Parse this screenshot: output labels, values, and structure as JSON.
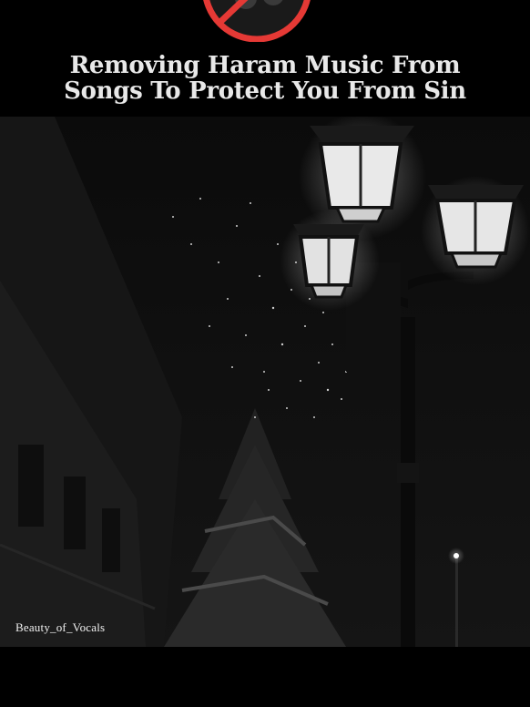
{
  "header": {
    "title_line_1": "Removing Haram Music From",
    "title_line_2": "Songs To Protect You From Sin",
    "logo_icon": "no-music-icon",
    "logo_color": "#e53935"
  },
  "video": {
    "watermark": "Beauty_of_Vocals"
  }
}
